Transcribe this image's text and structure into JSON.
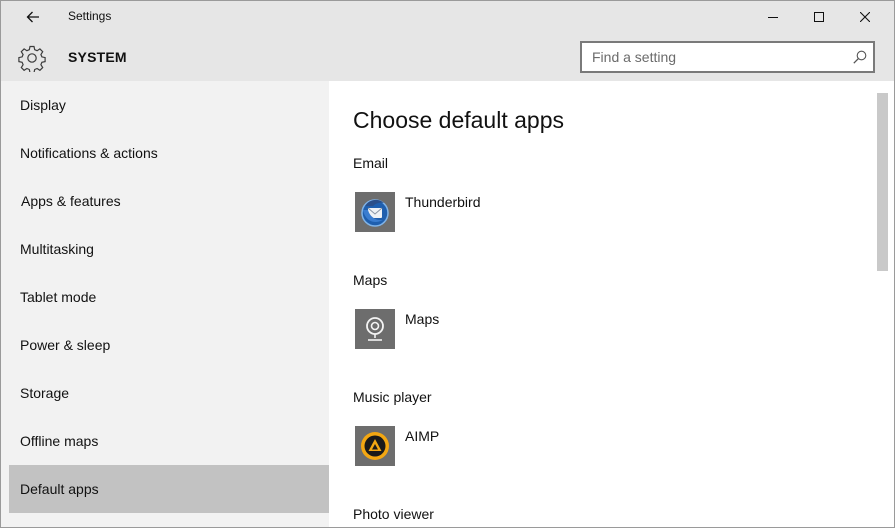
{
  "window": {
    "title": "Settings",
    "controls": {
      "minimize": "minimize-icon",
      "maximize": "maximize-icon",
      "close": "close-icon"
    }
  },
  "header": {
    "section_title": "SYSTEM",
    "search": {
      "placeholder": "Find a setting",
      "value": ""
    }
  },
  "sidebar": {
    "items": [
      {
        "label": "Display",
        "selected": false
      },
      {
        "label": "Notifications & actions",
        "selected": false
      },
      {
        "label": "Apps & features",
        "selected": false
      },
      {
        "label": "Multitasking",
        "selected": false
      },
      {
        "label": "Tablet mode",
        "selected": false
      },
      {
        "label": "Power & sleep",
        "selected": false
      },
      {
        "label": "Storage",
        "selected": false
      },
      {
        "label": "Offline maps",
        "selected": false
      },
      {
        "label": "Default apps",
        "selected": true
      }
    ]
  },
  "main": {
    "title": "Choose default apps",
    "categories": [
      {
        "label": "Email",
        "app": "Thunderbird",
        "icon": "thunderbird-icon"
      },
      {
        "label": "Maps",
        "app": "Maps",
        "icon": "maps-icon"
      },
      {
        "label": "Music player",
        "app": "AIMP",
        "icon": "aimp-icon"
      },
      {
        "label": "Photo viewer"
      }
    ]
  },
  "colors": {
    "titlebar": "#e6e6e6",
    "sidebar": "#f2f2f2",
    "selected_item": "#c2c2c2",
    "tile": "#6d6d6d"
  }
}
